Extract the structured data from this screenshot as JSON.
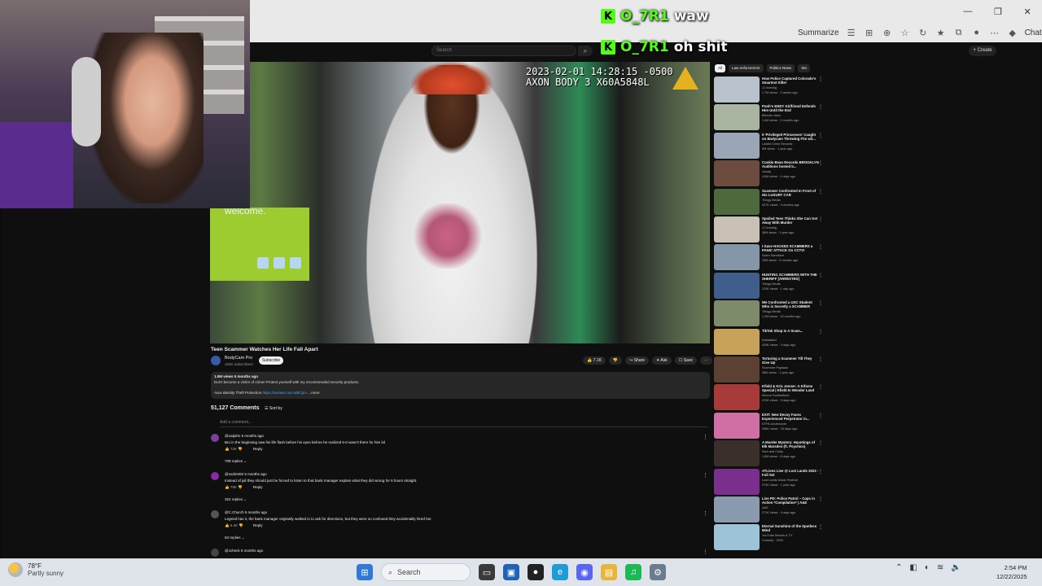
{
  "browser": {
    "summarize_label": "Summarize",
    "chat_label": "Chat",
    "win_minimize": "—",
    "win_restore": "❐",
    "win_close": "✕"
  },
  "chat_overlay": [
    {
      "user": "O_7R1",
      "message": "waw"
    },
    {
      "user": "O_7R1",
      "message": "oh shit"
    }
  ],
  "youtube": {
    "search_placeholder": "Search",
    "create_label": "+ Create",
    "video": {
      "timestamp": "2023-02-01 14:28:15 -0500\nAXON BODY 3 X60A5848L",
      "welcome_text": "welcome.",
      "title": "Teen Scammer Watches Her Life Fall Apart",
      "channel": "BodyCam Pro",
      "subscribers": "163K subscribers",
      "subscribe_label": "Subscribe",
      "likes": "7.1K",
      "share_label": "Share",
      "ask_label": "Ask",
      "save_label": "Save",
      "description_views": "1.0M views  5 months ago",
      "description_line1": "Don't become a victim of crime! Protect yourself with my recommended security products.",
      "description_line2_prefix": "Aura Identity Theft Protection",
      "description_link": "https://aurasec.sjv.io/BCpro",
      "description_more": "...more"
    },
    "comments": {
      "count": "51,127 Comments",
      "sort_label": "Sort by",
      "add_placeholder": "Add a comment...",
      "items": [
        {
          "user": "@oatjohn  5 months ago",
          "text": "Bro in the beginning saw his life flash before his eyes before he realized 5-0 wasn't there for him lol",
          "likes": "72K",
          "replies": "709 replies",
          "color": "#7b3fa0"
        },
        {
          "user": "@rack0492  5 months ago",
          "text": "Instead of jail they should just be forced to listen to that bank manager explain what they did wrong for 6 hours straight.",
          "likes": "79K",
          "replies": "322 replies",
          "color": "#8a2aa8"
        },
        {
          "user": "@C.Church  5 months ago",
          "text": "Legend has it, the bank manager originally walked in to ask for directions, but they were so confused they accidentally hired her.",
          "likes": "6.4K",
          "replies": "63 replies",
          "color": "#555555"
        },
        {
          "user": "@Jcheck  5 months ago",
          "text": "",
          "likes": "",
          "replies": "",
          "color": "#444444"
        }
      ],
      "reply_label": "Reply"
    },
    "sidebar": {
      "chips": [
        "All",
        "Law enforcement",
        "Politics News",
        "Wo"
      ],
      "videos": [
        {
          "title": "How Police Captured Colorado's Smartest Killer",
          "channel": "JJ Investig",
          "meta": "1.7M views · 2 weeks ago",
          "thumb": "#b8c2cc"
        },
        {
          "title": "Pooh's ENDY Girlfriend Defends Him Until the End",
          "channel": "Bleeder Jaws",
          "meta": "1.4M views · 2 months ago",
          "thumb": "#a9b4a1"
        },
        {
          "title": "5 'Privileged Princesses' Caught on Bodycam Throwing Fits wit...",
          "channel": "Lawful Crime Records",
          "meta": "9M views · 1 year ago",
          "thumb": "#9aa6b5"
        },
        {
          "title": "Cookie Bean Records BROOKLYN Auditions hosted b...",
          "channel": "cloudy",
          "meta": "4.6M views · 4 days ago",
          "thumb": "#6b4c3e"
        },
        {
          "title": "Scammer Confronted In Front of His LUXURY CAR",
          "channel": "Trilogy Media",
          "meta": "927K views · 4 months ago",
          "thumb": "#4e6a3c"
        },
        {
          "title": "Spoiled Teen Thinks She Can Get Away With Murder",
          "channel": "JJ Investig",
          "meta": "38M views · 1 year ago",
          "thumb": "#c9c1b6"
        },
        {
          "title": "I Gave HACKED SCAMMERS a PANIC ATTACK On CCTV!",
          "channel": "Scam Sandwich",
          "meta": "76M views · 9 months ago",
          "thumb": "#8596a8"
        },
        {
          "title": "HUNTING SCAMMERS WITH THE SHERIFF [ARRESTED]",
          "channel": "Trilogy Media",
          "meta": "123K views · 1 day ago",
          "thumb": "#3f5e8c"
        },
        {
          "title": "We Confronted a USC Student Who is Secretly a SCAMMER",
          "channel": "Trilogy Media",
          "meta": "1.2M views · 10 months ago",
          "thumb": "#7d8a6c"
        },
        {
          "title": "TikTok Shop Is A Scam...",
          "channel": "Kaiblasted",
          "meta": "429K views · 3 days ago",
          "thumb": "#c8a15a"
        },
        {
          "title": "Torturing a Scammer Till They Give Up",
          "channel": "Scammer Payback",
          "meta": "38M views · 1 year ago",
          "thumb": "#5c4033"
        },
        {
          "title": "Kfield & Kris Jenner: A Kifome Special | Kfield In Wonder Land",
          "channel": "Kifome Fontibelleari",
          "meta": "474K views · 3 days ago",
          "thumb": "#a83a3a"
        },
        {
          "title": "EXIT: New Decoy Faces Experienced Perpetrator in...",
          "channel": "DTPA Undercover",
          "meta": "256K views · 15 days ago",
          "thumb": "#d06fa4"
        },
        {
          "title": "A Murder Mystery: Hauntings of Elk Marsden (ft. Psychics)",
          "channel": "Sam and Colby",
          "meta": "1.8M views · 8 days ago",
          "thumb": "#3b2f2b"
        },
        {
          "title": "ATLiens Live @ Lost Lands 2023 - Full Set",
          "channel": "Lost Lands Music Festival",
          "meta": "374K views · 1 year ago",
          "thumb": "#7a2f8e"
        },
        {
          "title": "Live PD: Police Patrol – Cops in Action *Compilation* | A&E",
          "channel": "A&E",
          "meta": "271K views · 4 days ago",
          "thumb": "#8a9bb0"
        },
        {
          "title": "Eternal Sunshine of the Spotless Mind",
          "channel": "YouTube Movies & TV",
          "meta": "Comedy · 2004",
          "thumb": "#9cc3d8"
        }
      ]
    }
  },
  "taskbar": {
    "weather_temp": "78°F",
    "weather_desc": "Partly sunny",
    "search_label": "Search",
    "time": "2:54 PM",
    "date": "12/22/2025"
  }
}
